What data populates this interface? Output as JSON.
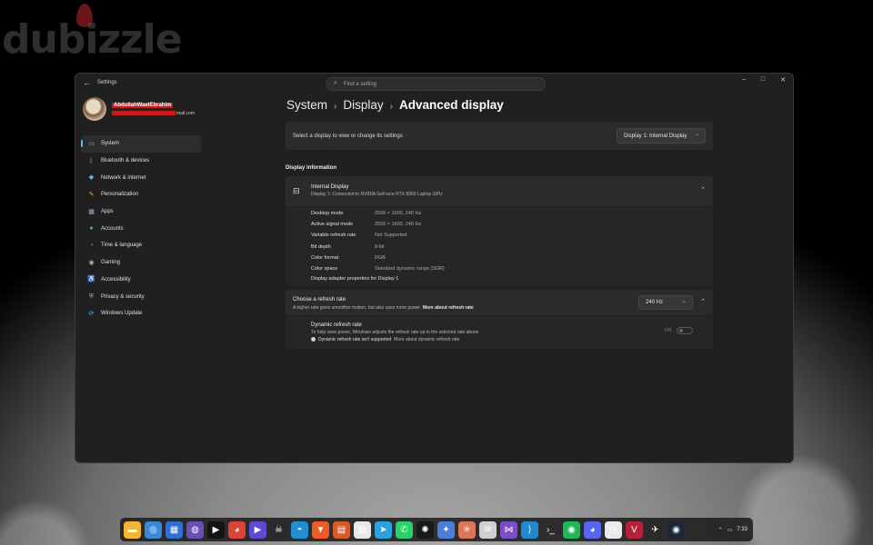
{
  "watermark": "dubizzle",
  "window": {
    "app_title": "Settings",
    "search_placeholder": "Find a setting",
    "controls": {
      "minimize": "–",
      "maximize": "□",
      "close": "✕"
    }
  },
  "profile": {
    "name": "AbdullahWaelEbrahim",
    "email_suffix": "mail.com"
  },
  "nav": [
    {
      "label": "System",
      "icon": "monitor-icon",
      "glyph": "▭",
      "color": "#4cc2ff",
      "active": true
    },
    {
      "label": "Bluetooth & devices",
      "icon": "bluetooth-icon",
      "glyph": "ᛒ",
      "color": "#4cc2ff"
    },
    {
      "label": "Network & internet",
      "icon": "wifi-icon",
      "glyph": "◆",
      "color": "#4cc2ff"
    },
    {
      "label": "Personalization",
      "icon": "brush-icon",
      "glyph": "✎",
      "color": "#f0a030"
    },
    {
      "label": "Apps",
      "icon": "apps-icon",
      "glyph": "▦",
      "color": "#9ab0c8"
    },
    {
      "label": "Accounts",
      "icon": "accounts-icon",
      "glyph": "●",
      "color": "#3ec77a"
    },
    {
      "label": "Time & language",
      "icon": "globe-clock-icon",
      "glyph": "◔",
      "color": "#4cc2ff"
    },
    {
      "label": "Gaming",
      "icon": "gamepad-icon",
      "glyph": "◉",
      "color": "#b0b0b0"
    },
    {
      "label": "Accessibility",
      "icon": "accessibility-icon",
      "glyph": "♿",
      "color": "#4cc2ff"
    },
    {
      "label": "Privacy & security",
      "icon": "shield-icon",
      "glyph": "⛨",
      "color": "#b0b0b0"
    },
    {
      "label": "Windows Update",
      "icon": "update-icon",
      "glyph": "⟳",
      "color": "#4cc2ff"
    }
  ],
  "breadcrumb": {
    "level1": "System",
    "level2": "Display",
    "current": "Advanced display",
    "separator": "›"
  },
  "select_display": {
    "label": "Select a display to view or change its settings",
    "value": "Display 1: Internal Display"
  },
  "display_info": {
    "section_title": "Display information",
    "name": "Internal Display",
    "connection": "Display 1: Connected to NVIDIA GeForce RTX 5060 Laptop GPU",
    "rows": [
      {
        "label": "Desktop mode",
        "value": "2560 × 1600, 240 Hz"
      },
      {
        "label": "Active signal mode",
        "value": "2560 × 1600, 240 Hz"
      },
      {
        "label": "Variable refresh rate",
        "value": "Not Supported"
      },
      {
        "label": "Bit depth",
        "value": "8-bit"
      },
      {
        "label": "Color format",
        "value": "RGB"
      },
      {
        "label": "Color space",
        "value": "Standard dynamic range (SDR)"
      }
    ],
    "adapter_link": "Display adapter properties for Display 1"
  },
  "refresh_rate": {
    "title": "Choose a refresh rate",
    "description": "A higher rate gives smoother motion, but also uses more power",
    "more_link": "More about refresh rate",
    "value": "240 Hz"
  },
  "dynamic_refresh": {
    "title": "Dynamic refresh rate",
    "description": "To help save power, Windows adjusts the refresh rate up to the selected rate above",
    "note": "Dynamic refresh rate isn't supported",
    "more_link": "More about dynamic refresh rate",
    "toggle_label": "Off",
    "toggle_on": false
  },
  "taskbar": {
    "apps": [
      {
        "name": "file-explorer-icon",
        "color": "#f2b632",
        "glyph": "▬"
      },
      {
        "name": "start-orb-icon",
        "color": "#3a88d8",
        "glyph": "◎"
      },
      {
        "name": "store-icon",
        "color": "#2f6fd1",
        "glyph": "▦"
      },
      {
        "name": "copilot-icon",
        "color": "#6b4fb8",
        "glyph": "◍"
      },
      {
        "name": "prime-video-icon",
        "color": "#141414",
        "glyph": "▶"
      },
      {
        "name": "chrome-icon",
        "color": "#db4437",
        "glyph": "◕"
      },
      {
        "name": "media-player-icon",
        "color": "#5b4bd6",
        "glyph": "▶"
      },
      {
        "name": "alienware-icon",
        "color": "#2a2a2a",
        "glyph": "☠"
      },
      {
        "name": "edge-icon",
        "color": "#1f8fd1",
        "glyph": "◓"
      },
      {
        "name": "brave-icon",
        "color": "#f05a24",
        "glyph": "▼"
      },
      {
        "name": "reader-icon",
        "color": "#d65a2a",
        "glyph": "▤"
      },
      {
        "name": "notes-icon",
        "color": "#e8e8e8",
        "glyph": "▥"
      },
      {
        "name": "telegram-icon",
        "color": "#2aa3e0",
        "glyph": "➤"
      },
      {
        "name": "whatsapp-icon",
        "color": "#25d366",
        "glyph": "✆"
      },
      {
        "name": "chatgpt-icon",
        "color": "#1a1a1a",
        "glyph": "✺"
      },
      {
        "name": "gemini-icon",
        "color": "#4a7fe0",
        "glyph": "✦"
      },
      {
        "name": "claude-icon",
        "color": "#d97757",
        "glyph": "✳"
      },
      {
        "name": "mail-icon",
        "color": "#d0d0d0",
        "glyph": "✉"
      },
      {
        "name": "visual-studio-icon",
        "color": "#7b4dc9",
        "glyph": "⋈"
      },
      {
        "name": "vscode-icon",
        "color": "#1f8ad2",
        "glyph": "⟩"
      },
      {
        "name": "terminal-icon",
        "color": "#2d2d2d",
        "glyph": "›_"
      },
      {
        "name": "spotify-icon",
        "color": "#1db954",
        "glyph": "◉"
      },
      {
        "name": "discord-icon",
        "color": "#5865f2",
        "glyph": "◕"
      },
      {
        "name": "clock-icon",
        "color": "#eaeaea",
        "glyph": "◷"
      },
      {
        "name": "valorant-icon",
        "color": "#b3213b",
        "glyph": "V"
      },
      {
        "name": "eagle-icon",
        "color": "#2a2a2a",
        "glyph": "✈"
      },
      {
        "name": "steam-icon",
        "color": "#1b2838",
        "glyph": "◉"
      }
    ],
    "clock": "7:33"
  }
}
